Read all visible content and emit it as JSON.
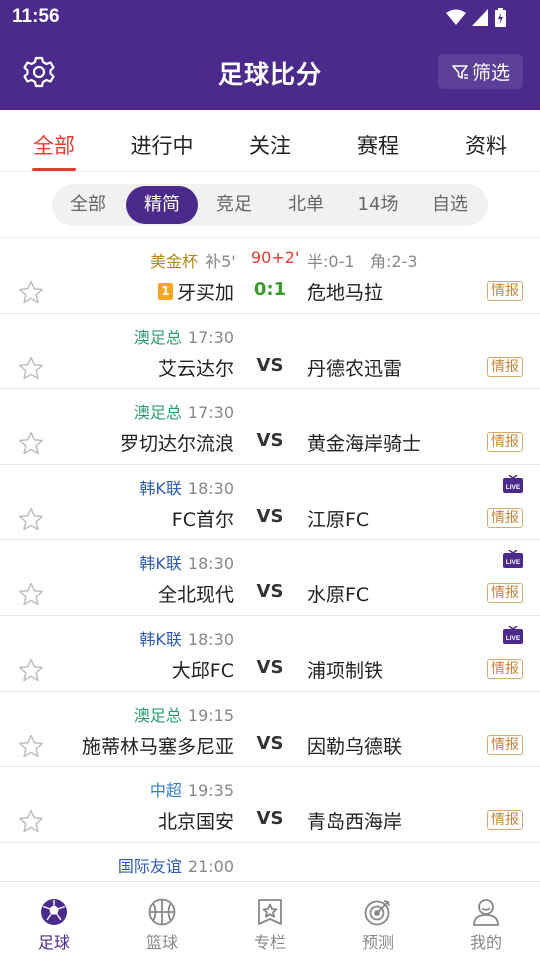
{
  "status": {
    "time": "11:56"
  },
  "header": {
    "title": "足球比分",
    "filter_label": "筛选"
  },
  "main_tabs": [
    {
      "label": "全部",
      "active": true
    },
    {
      "label": "进行中"
    },
    {
      "label": "关注"
    },
    {
      "label": "赛程"
    },
    {
      "label": "资料"
    }
  ],
  "sub_tabs": [
    {
      "label": "全部"
    },
    {
      "label": "精简",
      "active": true
    },
    {
      "label": "竞足"
    },
    {
      "label": "北单"
    },
    {
      "label": "14场"
    },
    {
      "label": "自选"
    }
  ],
  "colors": {
    "brand": "#4b2a8c",
    "accent_red": "#e33b2f",
    "league_aus": "#2a9d6f",
    "league_kor": "#2f5bb5",
    "league_gold": "#b08a18",
    "intel": "#c8853a",
    "score_green": "#3a9b2c"
  },
  "matches": [
    {
      "league": "美金杯",
      "league_color": "#b08a18",
      "extra": "补5'",
      "minute": "90+2'",
      "half": "半:0-1",
      "corner": "角:2-3",
      "home": "牙买加",
      "home_rank": "1",
      "center": "0:1",
      "away": "危地马拉",
      "intel": "情报",
      "live": false
    },
    {
      "league": "澳足总",
      "league_color": "#2a9d6f",
      "time": "17:30",
      "home": "艾云达尔",
      "center": "VS",
      "away": "丹德农迅雷",
      "intel": "情报",
      "live": false
    },
    {
      "league": "澳足总",
      "league_color": "#2a9d6f",
      "time": "17:30",
      "home": "罗切达尔流浪",
      "center": "VS",
      "away": "黄金海岸骑士",
      "intel": "情报",
      "live": false
    },
    {
      "league": "韩K联",
      "league_color": "#2f5bb5",
      "time": "18:30",
      "home": "FC首尔",
      "center": "VS",
      "away": "江原FC",
      "intel": "情报",
      "live": true
    },
    {
      "league": "韩K联",
      "league_color": "#2f5bb5",
      "time": "18:30",
      "home": "全北现代",
      "center": "VS",
      "away": "水原FC",
      "intel": "情报",
      "live": true
    },
    {
      "league": "韩K联",
      "league_color": "#2f5bb5",
      "time": "18:30",
      "home": "大邱FC",
      "center": "VS",
      "away": "浦项制铁",
      "intel": "情报",
      "live": true
    },
    {
      "league": "澳足总",
      "league_color": "#2a9d6f",
      "time": "19:15",
      "home": "施蒂林马塞多尼亚",
      "center": "VS",
      "away": "因勒乌德联",
      "intel": "情报",
      "live": false
    },
    {
      "league": "中超",
      "league_color": "#2f7fd6",
      "time": "19:35",
      "home": "北京国安",
      "center": "VS",
      "away": "青岛西海岸",
      "intel": "情报",
      "live": false
    },
    {
      "league": "国际友谊",
      "league_color": "#2f5bb5",
      "time": "21:00",
      "home": "",
      "center": "",
      "away": "",
      "intel": "",
      "live": false
    }
  ],
  "live_label": "LIVE",
  "bottom_nav": [
    {
      "label": "足球",
      "icon": "soccer-ball-icon",
      "active": true
    },
    {
      "label": "篮球",
      "icon": "basketball-icon"
    },
    {
      "label": "专栏",
      "icon": "column-badge-icon"
    },
    {
      "label": "预测",
      "icon": "target-icon"
    },
    {
      "label": "我的",
      "icon": "profile-icon"
    }
  ]
}
